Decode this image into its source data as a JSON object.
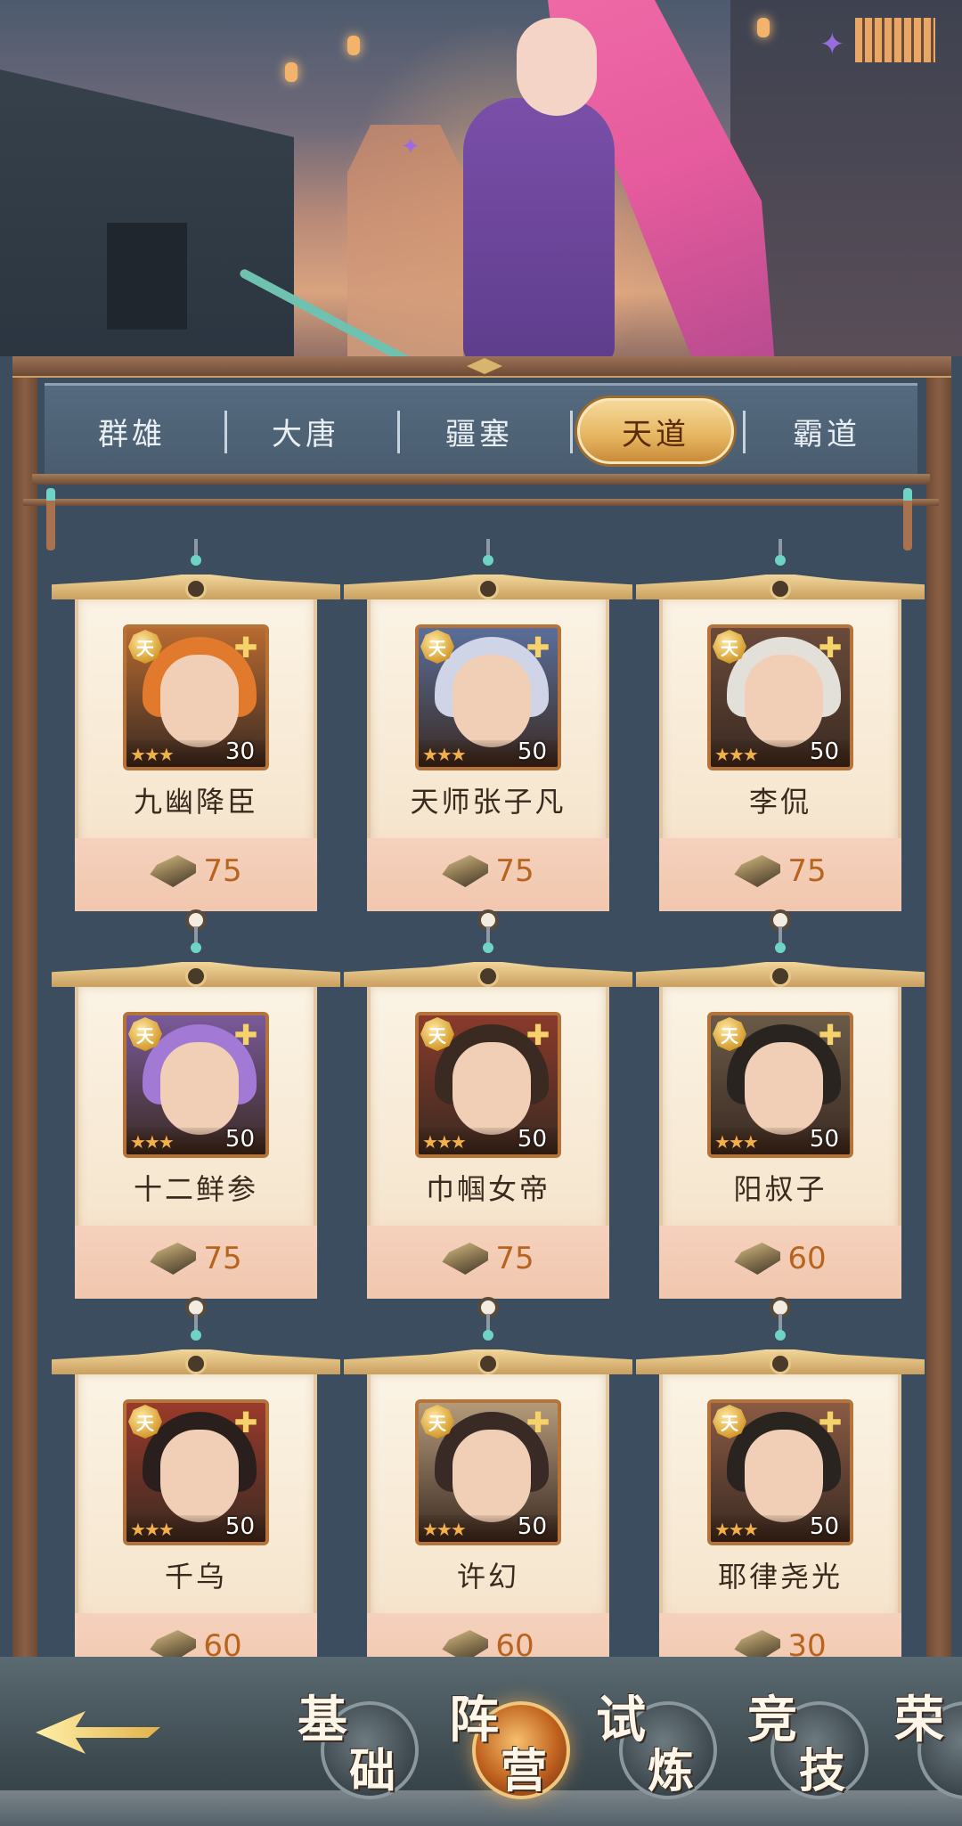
{
  "tabs": [
    {
      "label": "群雄",
      "active": false
    },
    {
      "label": "大唐",
      "active": false
    },
    {
      "label": "疆塞",
      "active": false
    },
    {
      "label": "天道",
      "active": true
    },
    {
      "label": "霸道",
      "active": false
    }
  ],
  "badge_label": "天",
  "heroes": [
    {
      "name": "九幽降臣",
      "level": "30",
      "cost": "75",
      "stars": 3,
      "hair": "#e27a2e",
      "bg": "#b86a30"
    },
    {
      "name": "天师张子凡",
      "level": "50",
      "cost": "75",
      "stars": 3,
      "hair": "#cfd4e6",
      "bg": "#5b6e9a"
    },
    {
      "name": "李侃",
      "level": "50",
      "cost": "75",
      "stars": 3,
      "hair": "#e3e0da",
      "bg": "#6a4a3a"
    },
    {
      "name": "十二鲜参",
      "level": "50",
      "cost": "75",
      "stars": 3,
      "hair": "#a27ad6",
      "bg": "#7a5a9a"
    },
    {
      "name": "巾帼女帝",
      "level": "50",
      "cost": "75",
      "stars": 3,
      "hair": "#3a2a22",
      "bg": "#8a3a2a"
    },
    {
      "name": "阳叔子",
      "level": "50",
      "cost": "60",
      "stars": 3,
      "hair": "#2a2420",
      "bg": "#6a5a48"
    },
    {
      "name": "千乌",
      "level": "50",
      "cost": "60",
      "stars": 3,
      "hair": "#2a1f1c",
      "bg": "#9a3a2a"
    },
    {
      "name": "许幻",
      "level": "50",
      "cost": "60",
      "stars": 3,
      "hair": "#3a2a26",
      "bg": "#b49a7a"
    },
    {
      "name": "耶律尧光",
      "level": "50",
      "cost": "30",
      "stars": 3,
      "hair": "#2a2420",
      "bg": "#8a5a44"
    }
  ],
  "nav": [
    {
      "c1": "基",
      "c2": "础",
      "active": false
    },
    {
      "c1": "阵",
      "c2": "营",
      "active": true
    },
    {
      "c1": "试",
      "c2": "炼",
      "active": false
    },
    {
      "c1": "竞",
      "c2": "技",
      "active": false
    },
    {
      "c1": "荣",
      "c2": "",
      "active": false
    }
  ]
}
